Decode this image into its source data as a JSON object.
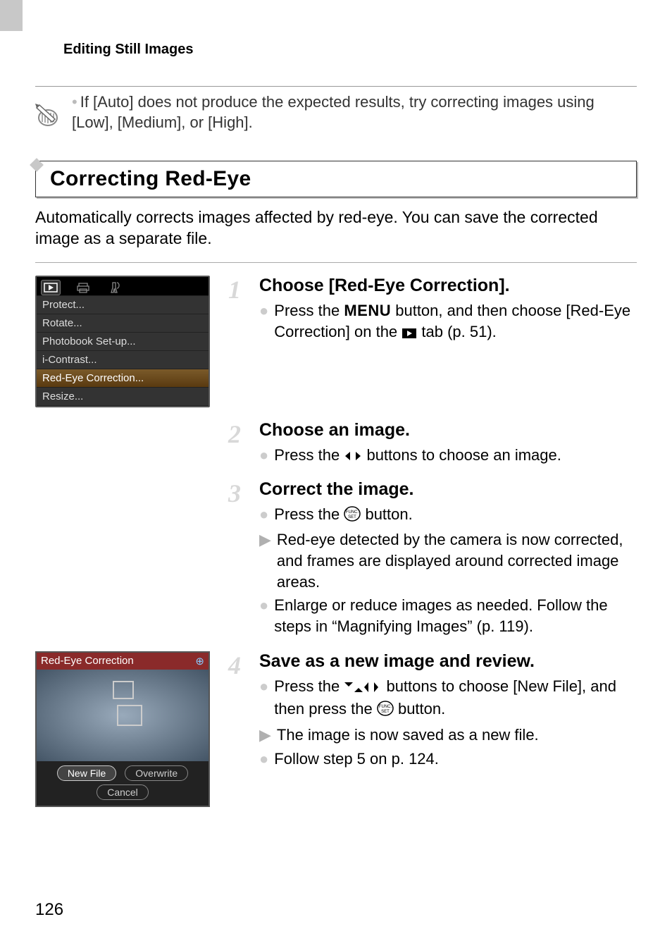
{
  "header": "Editing Still Images",
  "note": "If [Auto] does not produce the expected results, try correcting images using [Low], [Medium], or [High].",
  "section_title": "Correcting Red-Eye",
  "intro": "Automatically corrects images affected by red-eye. You can save the corrected image as a separate file.",
  "menu": {
    "items": [
      "Protect...",
      "Rotate...",
      "Photobook Set-up...",
      "i-Contrast...",
      "Red-Eye Correction...",
      "Resize..."
    ]
  },
  "steps": [
    {
      "num": "1",
      "title": "Choose [Red-Eye Correction].",
      "items": [
        {
          "type": "bullet",
          "text_pre": "Press the ",
          "text_mid": "MENU",
          "text_post": " button, and then choose [Red-Eye Correction] on the ",
          "text_tail": " tab (p. 51)."
        }
      ]
    },
    {
      "num": "2",
      "title": "Choose an image.",
      "items": [
        {
          "type": "bullet",
          "text_pre": "Press the ",
          "text_post": " buttons to choose an image."
        }
      ]
    },
    {
      "num": "3",
      "title": "Correct the image.",
      "items": [
        {
          "type": "bullet",
          "text_pre": "Press the ",
          "text_post": " button."
        },
        {
          "type": "tri",
          "text": "Red-eye detected by the camera is now corrected, and frames are displayed around corrected image areas."
        },
        {
          "type": "bullet",
          "text": "Enlarge or reduce images as needed. Follow the steps in “Magnifying Images” (p. 119)."
        }
      ]
    },
    {
      "num": "4",
      "title": "Save as a new image and review.",
      "items": [
        {
          "type": "bullet",
          "text_pre": "Press the ",
          "text_mid": " buttons to choose [New File], and then press the ",
          "text_post": " button."
        },
        {
          "type": "tri",
          "text": "The image is now saved as a new file."
        },
        {
          "type": "bullet",
          "text": "Follow step 5 on p. 124."
        }
      ]
    }
  ],
  "redeye_panel": {
    "title": "Red-Eye Correction",
    "options": {
      "new_file": "New File",
      "overwrite": "Overwrite",
      "cancel": "Cancel"
    }
  },
  "page_number": "126"
}
